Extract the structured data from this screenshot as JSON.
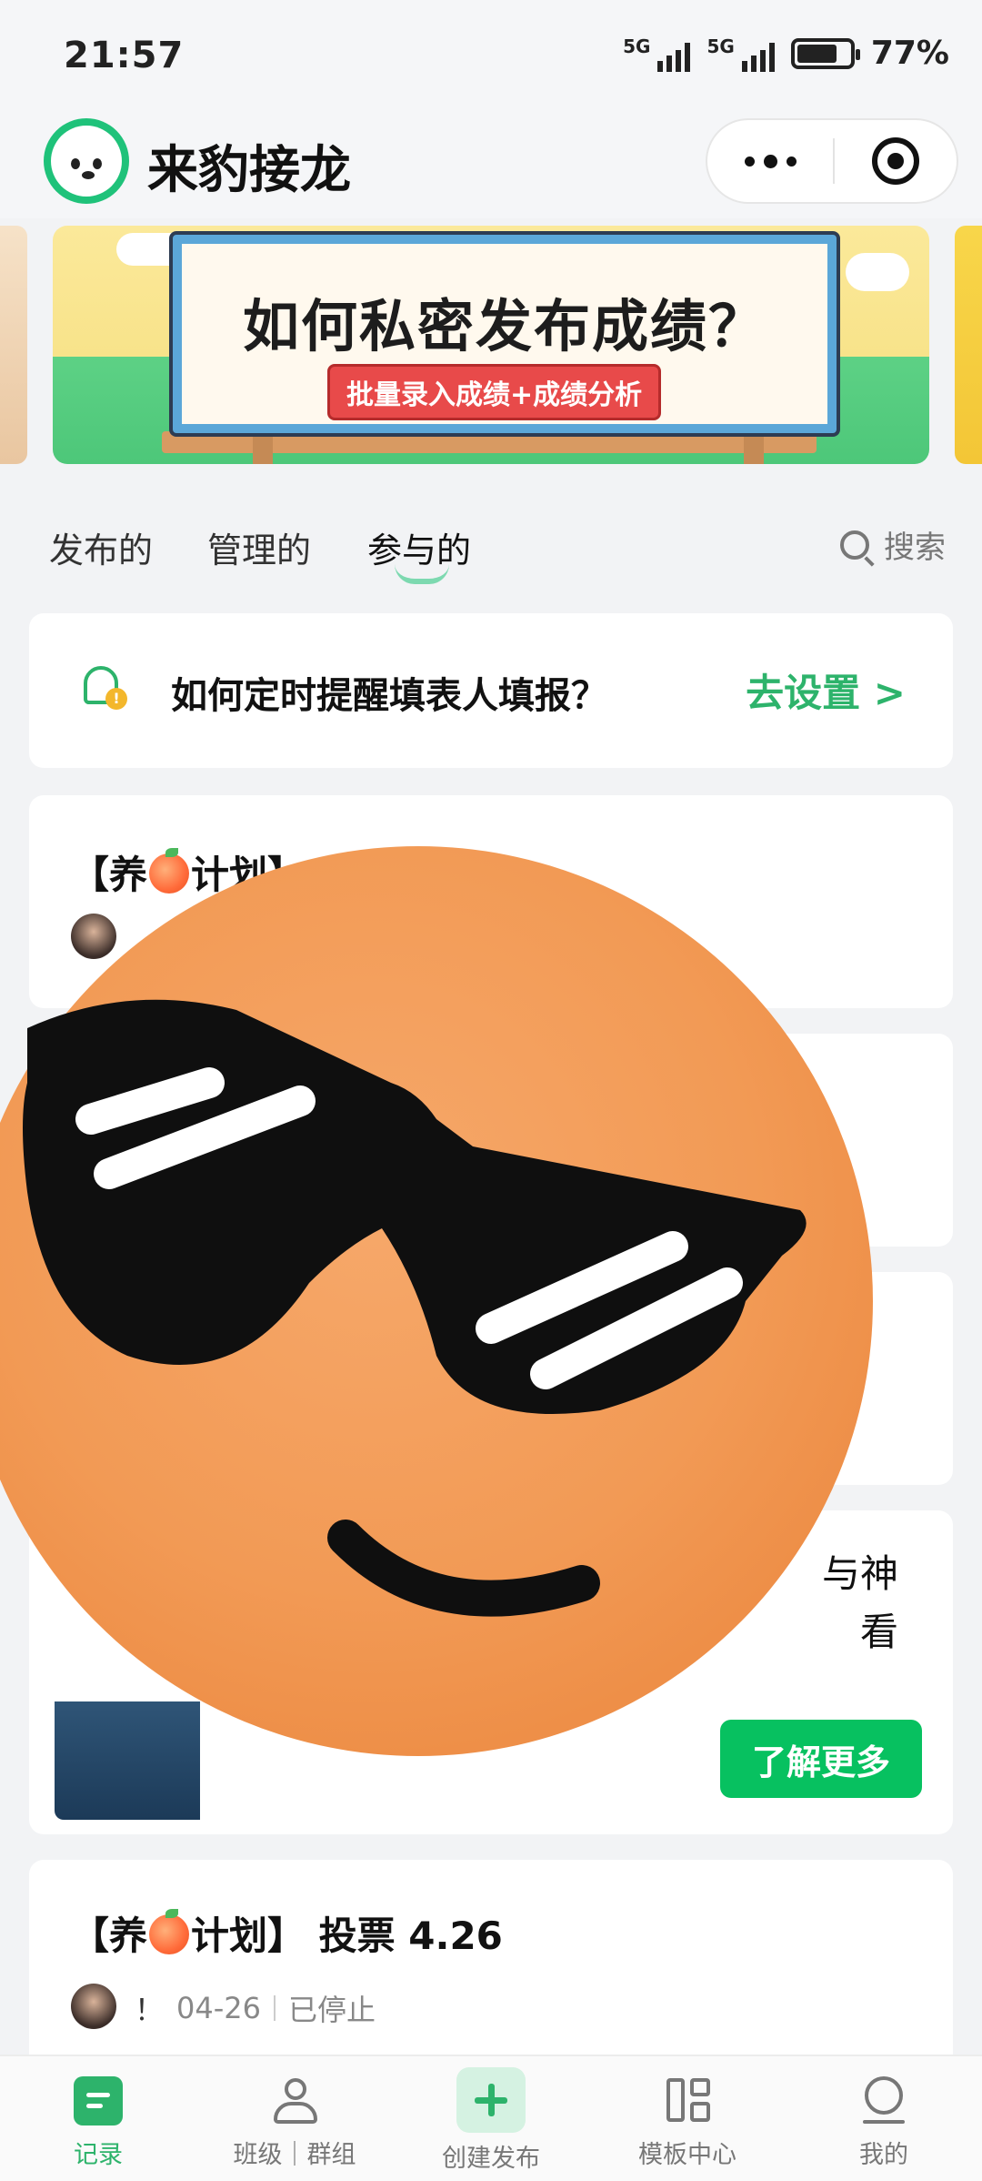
{
  "status_bar": {
    "time": "21:57",
    "network_1": "5G",
    "network_2": "5G",
    "battery_percent": "77%",
    "battery_level": 0.77
  },
  "header": {
    "app_title": "来豹接龙",
    "more_icon": "more-dots-icon",
    "close_icon": "target-circle-icon"
  },
  "banner": {
    "title": "如何私密发布成绩？",
    "tag": "批量录入成绩+成绩分析"
  },
  "tabs": {
    "items": [
      "发布的",
      "管理的",
      "参与的"
    ],
    "active_index": 2,
    "search_label": "搜索"
  },
  "reminder": {
    "text": "如何定时提醒填表人填报？",
    "link": "去设置 >"
  },
  "records": [
    {
      "title_prefix": "【养",
      "title_suffix": "计划】 巨新",
      "meta": []
    },
    {
      "title_prefix": "",
      "title_suffix": "",
      "meta": []
    },
    {
      "title_prefix": "",
      "title_suffix": "",
      "meta": []
    },
    {
      "text_line1": "与神",
      "text_line2": "看",
      "button": "了解更多"
    },
    {
      "title_prefix": "【养",
      "title_suffix": "计划】 投票 4.26",
      "author": "！",
      "date": "04-26",
      "status": "已停止"
    }
  ],
  "bottom_nav": [
    {
      "label": "记录",
      "icon": "records-icon",
      "active": true
    },
    {
      "label": "班级｜群组",
      "icon": "people-icon",
      "active": false
    },
    {
      "label": "创建发布",
      "icon": "plus-icon",
      "active": false
    },
    {
      "label": "模板中心",
      "icon": "template-grid-icon",
      "active": false
    },
    {
      "label": "我的",
      "icon": "user-icon",
      "active": false
    }
  ],
  "colors": {
    "brand_green": "#2db36b",
    "button_green": "#07c160",
    "background": "#f2f3f5"
  }
}
